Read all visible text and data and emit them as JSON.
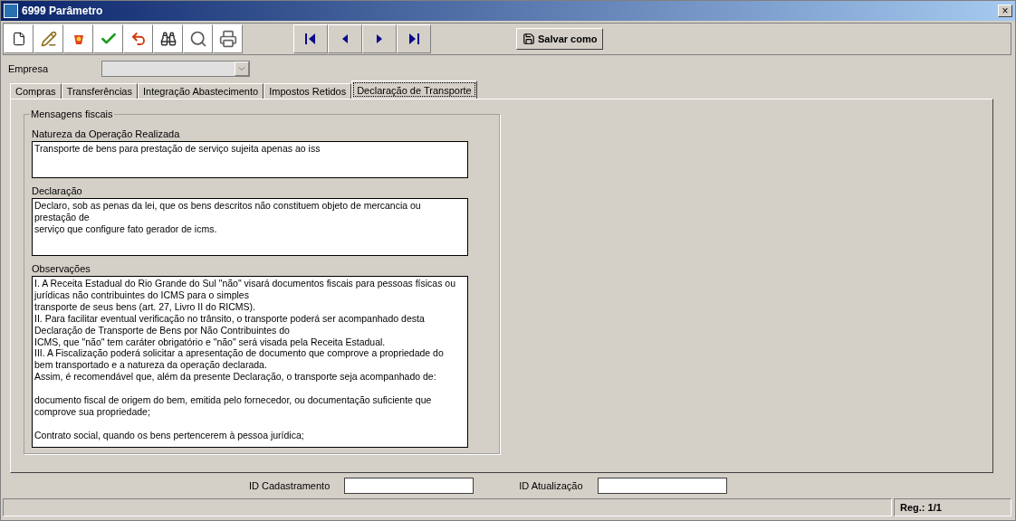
{
  "window": {
    "title": "6999 Parâmetro",
    "close": "×"
  },
  "toolbar": {
    "save_as": "Salvar como"
  },
  "empresa": {
    "label": "Empresa",
    "disabled": true
  },
  "tabs": [
    {
      "label": "Compras",
      "selected": false
    },
    {
      "label": "Transferências",
      "selected": false
    },
    {
      "label": "Integração Abastecimento",
      "selected": false
    },
    {
      "label": "Impostos Retidos",
      "selected": false
    },
    {
      "label": "Declaração de Transporte",
      "selected": true
    }
  ],
  "group": {
    "title": "Mensagens fiscais",
    "fields": [
      {
        "label": "Natureza da Operação Realizada",
        "value": "Transporte de bens para prestação de serviço sujeita apenas ao iss"
      },
      {
        "label": "Declaração",
        "value": "Declaro, sob as penas da lei, que os bens descritos não constituem objeto de mercancia ou\nprestação de\nserviço que configure fato gerador de icms."
      },
      {
        "label": "Observações",
        "value": "I. A Receita Estadual do Rio Grande do Sul \"não\" visará documentos fiscais para pessoas físicas ou\njurídicas não contribuintes do ICMS para o simples\ntransporte de seus bens (art. 27, Livro II do RICMS).\nII. Para facilitar eventual verificação no trânsito, o transporte poderá ser acompanhado desta\nDeclaração de Transporte de Bens por Não Contribuintes do\nICMS, que \"não\" tem caráter obrigatório e \"não\" será visada pela Receita Estadual.\nIII. A Fiscalização poderá solicitar a apresentação de documento que comprove a propriedade do\nbem transportado e a natureza da operação declarada.\nAssim, é recomendável que, além da presente Declaração, o transporte seja acompanhado de:\n\ndocumento fiscal de origem do bem, emitida pelo fornecedor, ou documentação suficiente que\ncomprove sua propriedade;\n\nContrato social, quando os bens pertencerem à pessoa jurídica;"
      }
    ]
  },
  "footer": [
    {
      "label": "ID Cadastramento"
    },
    {
      "label": "ID Atualização"
    }
  ],
  "status_bar": {
    "record": "Reg.: 1/1"
  }
}
